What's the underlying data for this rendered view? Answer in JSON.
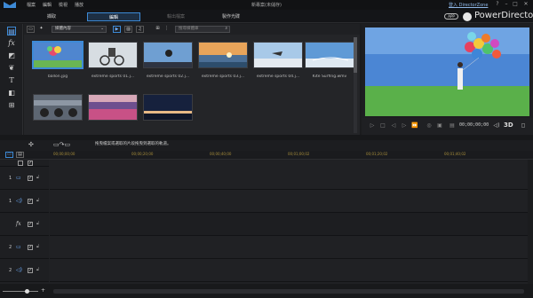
{
  "menu": [
    "檔案",
    "編輯",
    "檢視",
    "播放"
  ],
  "doc_title": "新專案(未儲存)",
  "mode_tabs": [
    {
      "label": "擷取"
    },
    {
      "label": "編輯"
    },
    {
      "label": "輸出檔案"
    },
    {
      "label": "製作光碟"
    }
  ],
  "header": {
    "director_zone": "登入 DirectorZone",
    "app_badge": "APP",
    "brand": "PowerDirector",
    "window_controls": [
      "?",
      "–",
      "□",
      "✕"
    ]
  },
  "library": {
    "filter_value": "媒體內容",
    "search_placeholder": "搜尋媒體庫",
    "items": [
      {
        "label": "ballon.jpg",
        "colors": [
          "#5e8fd0",
          "#7ec06a"
        ]
      },
      {
        "label": "extreme sports 01.j...",
        "colors": [
          "#cfd6dc",
          "#8f9aa3"
        ]
      },
      {
        "label": "extreme sports 02.j...",
        "colors": [
          "#7aa7d6",
          "#2d3b52"
        ]
      },
      {
        "label": "extreme sports 03.j...",
        "colors": [
          "#e9a45a",
          "#3a5f86"
        ]
      },
      {
        "label": "extreme sports 04.j...",
        "colors": [
          "#9fc3e6",
          "#e0e6ec"
        ]
      },
      {
        "label": "Kite Surfing.wmv",
        "colors": [
          "#6fa6dc",
          "#e7eef4"
        ]
      },
      {
        "label": "",
        "colors": [
          "#6b7684",
          "#3d4550"
        ]
      },
      {
        "label": "",
        "colors": [
          "#6c4a8a",
          "#d65f8e"
        ]
      },
      {
        "label": "",
        "colors": [
          "#1d2a4a",
          "#e2b98b"
        ]
      }
    ]
  },
  "tools": [
    "media-room",
    "fx-room",
    "pip-room",
    "particle-room",
    "title-room",
    "transition-room",
    "audio-mixing-room"
  ],
  "preview": {
    "timecode": "00;00;00;00",
    "three_d": "3D"
  },
  "timeline": {
    "hint": "拖曳檔案或選取的片段拖曳到選取的軌道。",
    "ruler": [
      "00;00;00;00",
      "00;00;20;00",
      "00;00;40;00",
      "00;01;00;02",
      "00;01;20;02",
      "00;01;40;02"
    ],
    "tracks": [
      {
        "num": "1",
        "icon": "video",
        "symbol": "▭"
      },
      {
        "num": "1",
        "icon": "audio",
        "symbol": "◁)"
      },
      {
        "num": "",
        "icon": "fx",
        "symbol": "fx"
      },
      {
        "num": "2",
        "icon": "video",
        "symbol": "▭"
      },
      {
        "num": "2",
        "icon": "audio",
        "symbol": "◁)"
      }
    ]
  },
  "colors": {
    "accent": "#3d8ad6",
    "ruler_text": "#a58b3a"
  }
}
